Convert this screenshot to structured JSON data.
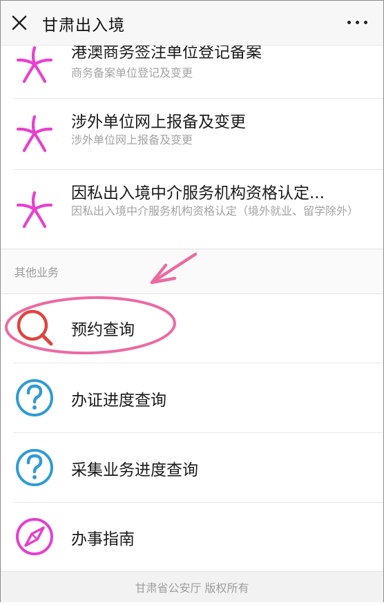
{
  "header": {
    "title": "甘肃出入境",
    "close_icon": "close-icon",
    "more_icon": "more-dots-icon"
  },
  "registration_items": [
    {
      "title": "港澳商务签注单位登记备案",
      "subtitle": "商务备案单位登记及变更",
      "icon": "star-icon"
    },
    {
      "title": "涉外单位网上报备及变更",
      "subtitle": "涉外单位网上报备及变更",
      "icon": "star-icon"
    },
    {
      "title": "因私出入境中介服务机构资格认定...",
      "subtitle": "因私出入境中介服务机构资格认定（境外就业、留学除外）",
      "icon": "star-icon"
    }
  ],
  "other_section": {
    "label": "其他业务",
    "items": [
      {
        "title": "预约查询",
        "icon": "search-icon"
      },
      {
        "title": "办证进度查询",
        "icon": "question-icon"
      },
      {
        "title": "采集业务进度查询",
        "icon": "question-icon"
      },
      {
        "title": "办事指南",
        "icon": "compass-icon"
      }
    ]
  },
  "footer": {
    "text": "甘肃省公安厅 版权所有"
  },
  "colors": {
    "star_pink": "#e93fcf",
    "search_red": "#e0443e",
    "question_blue": "#2f9bd4",
    "compass_pink": "#e63fcf",
    "annotation_pink": "#ec6aa2"
  }
}
